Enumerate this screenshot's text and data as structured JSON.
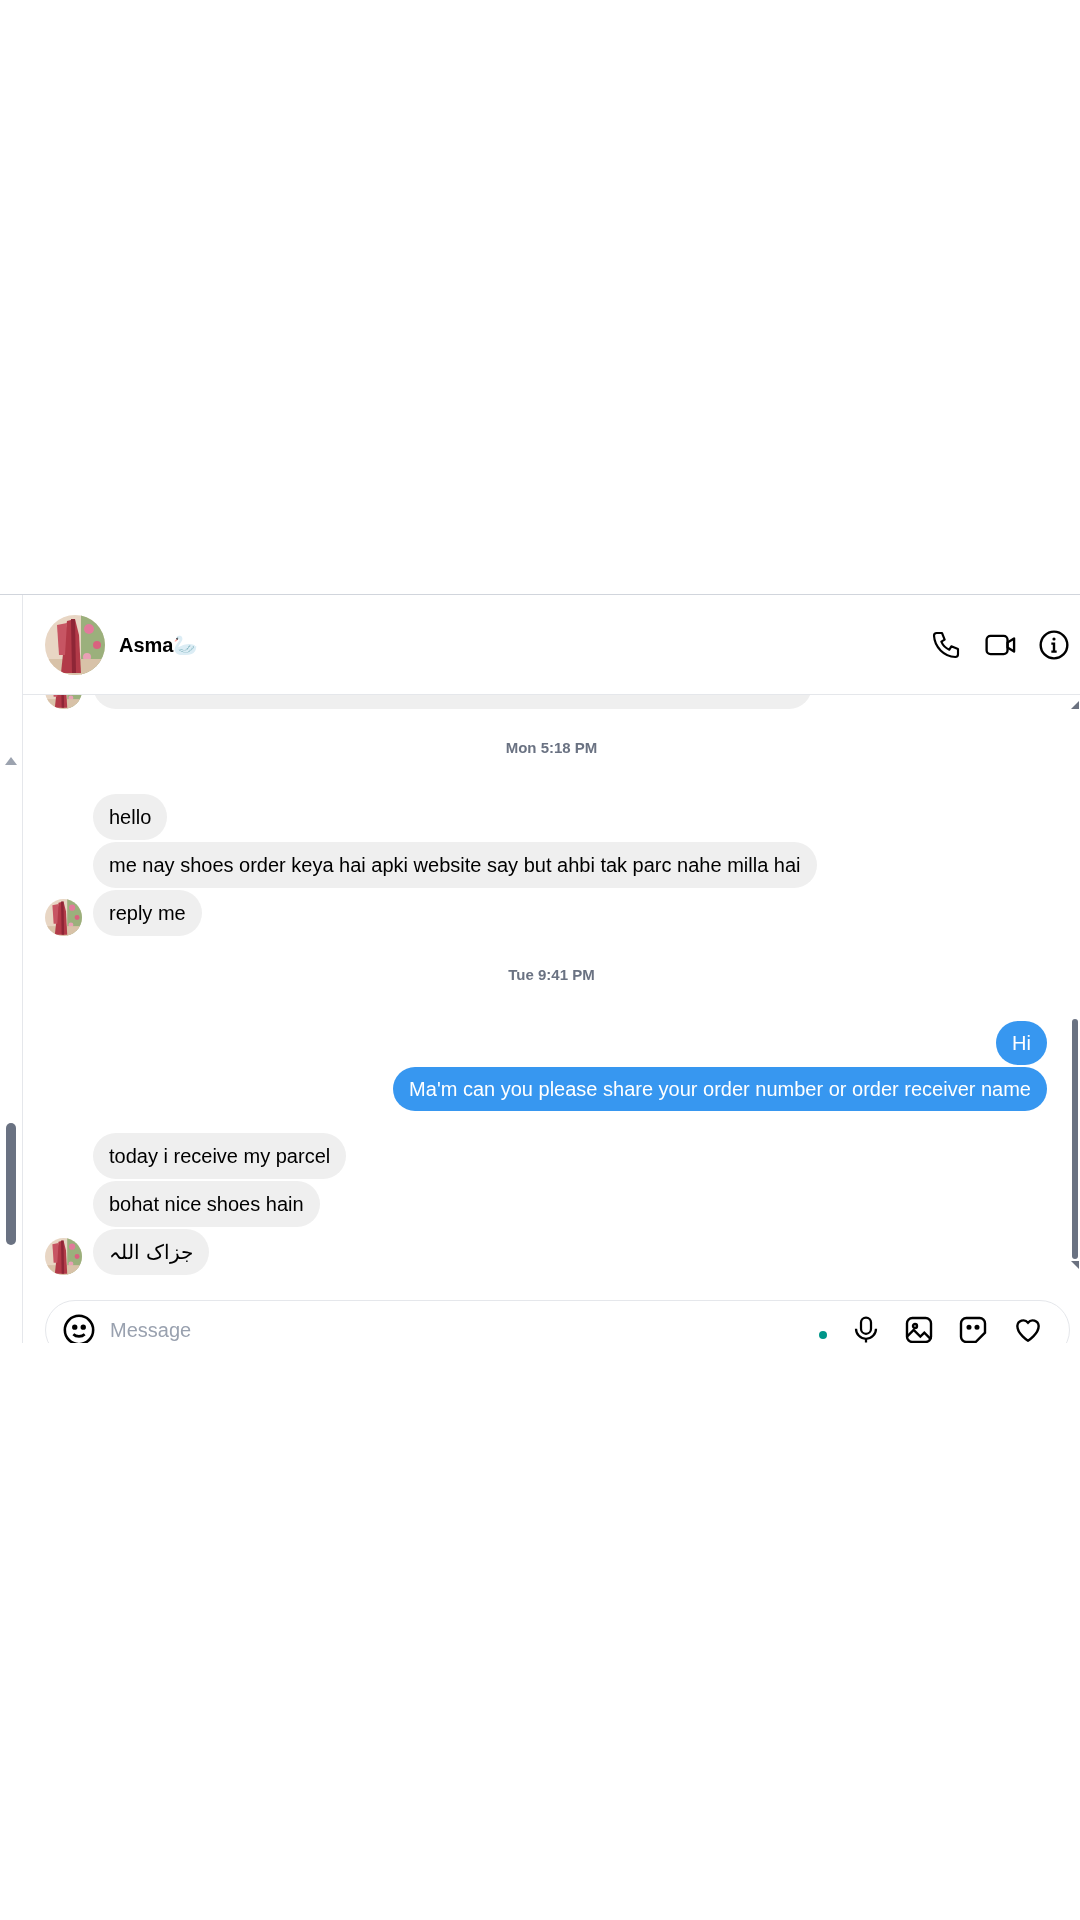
{
  "contact": {
    "name": "Asma",
    "emoji": "🦢"
  },
  "messages": [
    {
      "kind": "cut",
      "avatar": true
    },
    {
      "kind": "timestamp",
      "text": "Mon 5:18 PM"
    },
    {
      "kind": "incoming",
      "text": "hello",
      "avatar": false
    },
    {
      "kind": "incoming",
      "text": "me nay shoes order keya hai apki website say but ahbi tak parc nahe milla hai",
      "avatar": false
    },
    {
      "kind": "incoming",
      "text": "reply me",
      "avatar": true
    },
    {
      "kind": "timestamp",
      "text": "Tue 9:41 PM"
    },
    {
      "kind": "outgoing",
      "text": "Hi"
    },
    {
      "kind": "outgoing",
      "text": "Ma'm can you please share your order number or order receiver name"
    },
    {
      "kind": "incoming",
      "text": "today i receive my parcel",
      "avatar": false
    },
    {
      "kind": "incoming",
      "text": "bohat nice shoes hain",
      "avatar": false
    },
    {
      "kind": "incoming",
      "text": "جزاک اللہ",
      "avatar": true
    }
  ],
  "composer": {
    "placeholder": "Message"
  }
}
